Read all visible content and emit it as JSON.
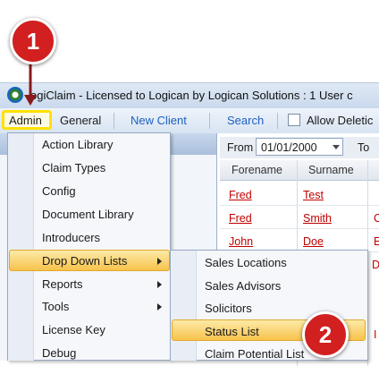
{
  "window": {
    "title": "ogiClaim - Licensed to Logican by Logican Solutions : 1 User c"
  },
  "menubar": {
    "admin": "Admin",
    "general": "General",
    "new_client": "New Client",
    "search": "Search",
    "allow_deletion": "Allow Deletic"
  },
  "filter": {
    "from_label": "From",
    "from_date": "01/01/2000",
    "to_label": "To"
  },
  "grid": {
    "columns": [
      "Forename",
      "Surname"
    ],
    "rows": [
      {
        "forename": "Fred",
        "surname": "Test",
        "extra": ""
      },
      {
        "forename": "Fred",
        "surname": "Smith",
        "extra": "C"
      },
      {
        "forename": "John",
        "surname": "Doe",
        "extra": "E"
      }
    ],
    "stub_d": "D",
    "stub_i": "I"
  },
  "admin_menu": {
    "items": [
      "Action Library",
      "Claim Types",
      "Config",
      "Document Library",
      "Introducers",
      "Drop Down Lists",
      "Reports",
      "Tools",
      "License Key",
      "Debug"
    ]
  },
  "dropdown_submenu": {
    "items": [
      "Sales Locations",
      "Sales Advisors",
      "Solicitors",
      "Status List",
      "Claim Potential List"
    ]
  },
  "callouts": {
    "step1": "1",
    "step2": "2"
  },
  "colors": {
    "highlight": "#f7c34c",
    "callout": "#d21f1f",
    "admin_outline": "#ffe100"
  }
}
